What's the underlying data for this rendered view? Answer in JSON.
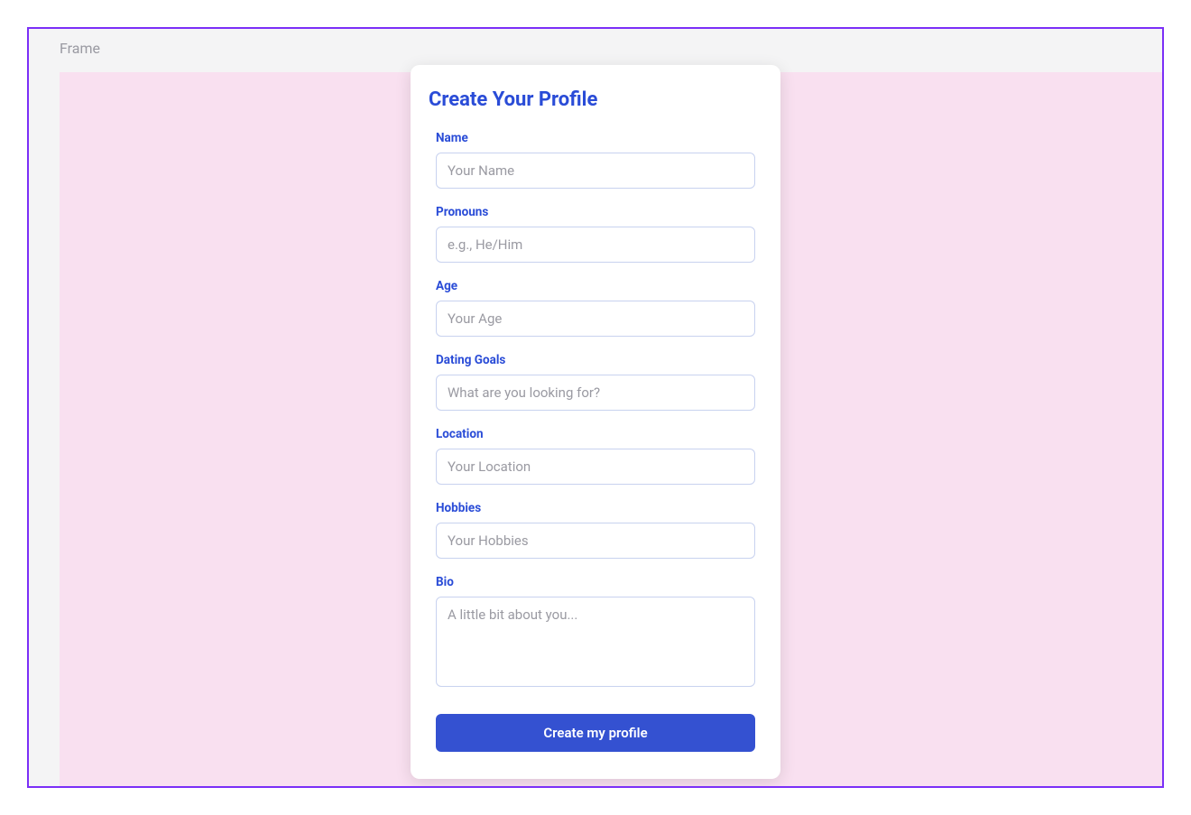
{
  "frame": {
    "label": "Frame"
  },
  "card": {
    "title": "Create Your Profile",
    "fields": {
      "name": {
        "label": "Name",
        "placeholder": "Your Name"
      },
      "pronouns": {
        "label": "Pronouns",
        "placeholder": "e.g., He/Him"
      },
      "age": {
        "label": "Age",
        "placeholder": "Your Age"
      },
      "dating_goals": {
        "label": "Dating Goals",
        "placeholder": "What are you looking for?"
      },
      "location": {
        "label": "Location",
        "placeholder": "Your Location"
      },
      "hobbies": {
        "label": "Hobbies",
        "placeholder": "Your Hobbies"
      },
      "bio": {
        "label": "Bio",
        "placeholder": "A little bit about you..."
      }
    },
    "submit_label": "Create my profile"
  }
}
